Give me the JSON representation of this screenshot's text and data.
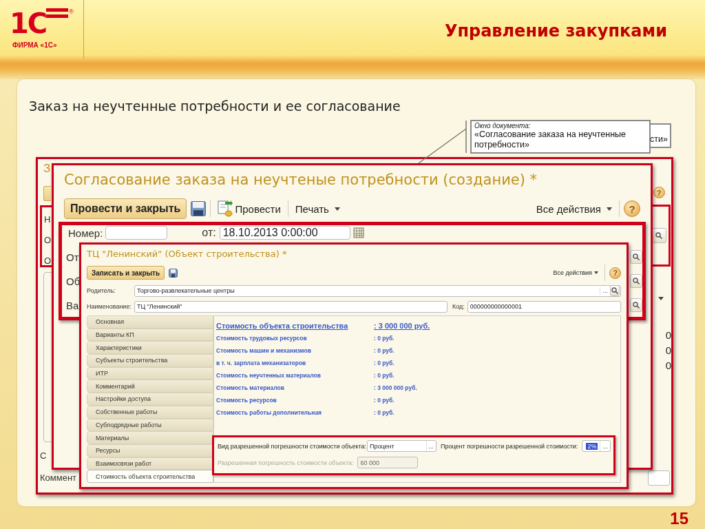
{
  "header": {
    "logo_text": "1С",
    "logo_mark": "®",
    "company": "ФИРМА «1С»",
    "title": "Управление закупками"
  },
  "slide_title": "Заказ на неучтенные потребности и ее согласование",
  "callout": {
    "caption": "Окно документа:",
    "text": "«Согласование заказа на неучтенные потребности»",
    "text_behind": "сти»"
  },
  "back_window": {
    "title": "З",
    "labels": [
      "Н",
      "О",
      "О"
    ],
    "bottom_labels": [
      "С",
      "Коммент"
    ],
    "help": "?",
    "values": [
      "0",
      "0",
      "0"
    ]
  },
  "order_window": {
    "title": "Согласование заказа на неучтеные потребности (создание) *",
    "toolbar": [
      {
        "kind": "default",
        "label": "Провести и закрыть"
      },
      {
        "kind": "save"
      },
      {
        "kind": "post",
        "label": "Провести"
      },
      {
        "kind": "menu",
        "label": "Печать"
      }
    ],
    "all_actions": "Все действия",
    "help": "?",
    "number_label": "Номер:",
    "date": {
      "label": "от:",
      "value": "18.10.2013 0:00:00"
    },
    "partial_labels": [
      "От",
      "Об",
      "Ва"
    ]
  },
  "object_window": {
    "title": "ТЦ \"Ленинский\" (Объект строительства) *",
    "save_close": "Записать и закрыть",
    "all_actions": "Все действия",
    "help": "?",
    "parent": {
      "label": "Родитель:",
      "value": "Торгово-развлекательные центры",
      "button": "..."
    },
    "name": {
      "label": "Наименование:",
      "value": "ТЦ \"Ленинский\""
    },
    "code": {
      "label": "Код:",
      "value": "000000000000001"
    },
    "tabs": [
      {
        "label": "Основная",
        "selected": false
      },
      {
        "label": "Варианты КП",
        "selected": false
      },
      {
        "label": "Характеристики",
        "selected": false
      },
      {
        "label": "Субъекты строительства",
        "selected": false
      },
      {
        "label": "ИТР",
        "selected": false
      },
      {
        "label": "Комментарий",
        "selected": false
      },
      {
        "label": "Настройки доступа",
        "selected": false
      },
      {
        "label": "Собственные работы",
        "selected": false
      },
      {
        "label": "Субподрядные работы",
        "selected": false
      },
      {
        "label": "Материалы",
        "selected": false
      },
      {
        "label": "Ресурсы",
        "selected": false
      },
      {
        "label": "Взаимосвязи работ",
        "selected": false
      },
      {
        "label": "Стоимость объекта строительства",
        "selected": true
      }
    ],
    "costs": [
      {
        "kind": "total",
        "label": "Стоимость объекта строительства",
        "value": ": 3 000 000 руб."
      },
      {
        "kind": "line",
        "label": "Стоимость трудовых ресурсов",
        "value": ": 0 руб."
      },
      {
        "kind": "line",
        "label": "Стоимость машин и механизмов",
        "value": ": 0 руб."
      },
      {
        "kind": "line",
        "label": "в т. ч. зарплата механизаторов",
        "value": ": 0 руб."
      },
      {
        "kind": "line",
        "label": "Стоимость неучтенных материалов",
        "value": ": 0 руб."
      },
      {
        "kind": "line",
        "label": "Стоимость материалов",
        "value": ": 3 000 000 руб."
      },
      {
        "kind": "line",
        "label": "Стоимость ресурсов",
        "value": ": 0 руб."
      },
      {
        "kind": "line",
        "label": "Стоимость работы дополнительная",
        "value": ": 0 руб."
      }
    ],
    "tolerance": [
      [
        {
          "label": "Вид разрешенной погрешности стоимости объекта:",
          "value": "Процент",
          "button": "...",
          "disabled": false,
          "highlighted": false
        },
        {
          "label": "Процент погрешности разрешенной стоимости:",
          "value": "2%",
          "button": "...",
          "disabled": false,
          "highlighted": true
        }
      ],
      [
        {
          "label": "Разрешенная погрешность стоимости объекта:",
          "value": "60 000",
          "disabled": true,
          "highlighted": false
        }
      ]
    ]
  },
  "page_number": "15"
}
